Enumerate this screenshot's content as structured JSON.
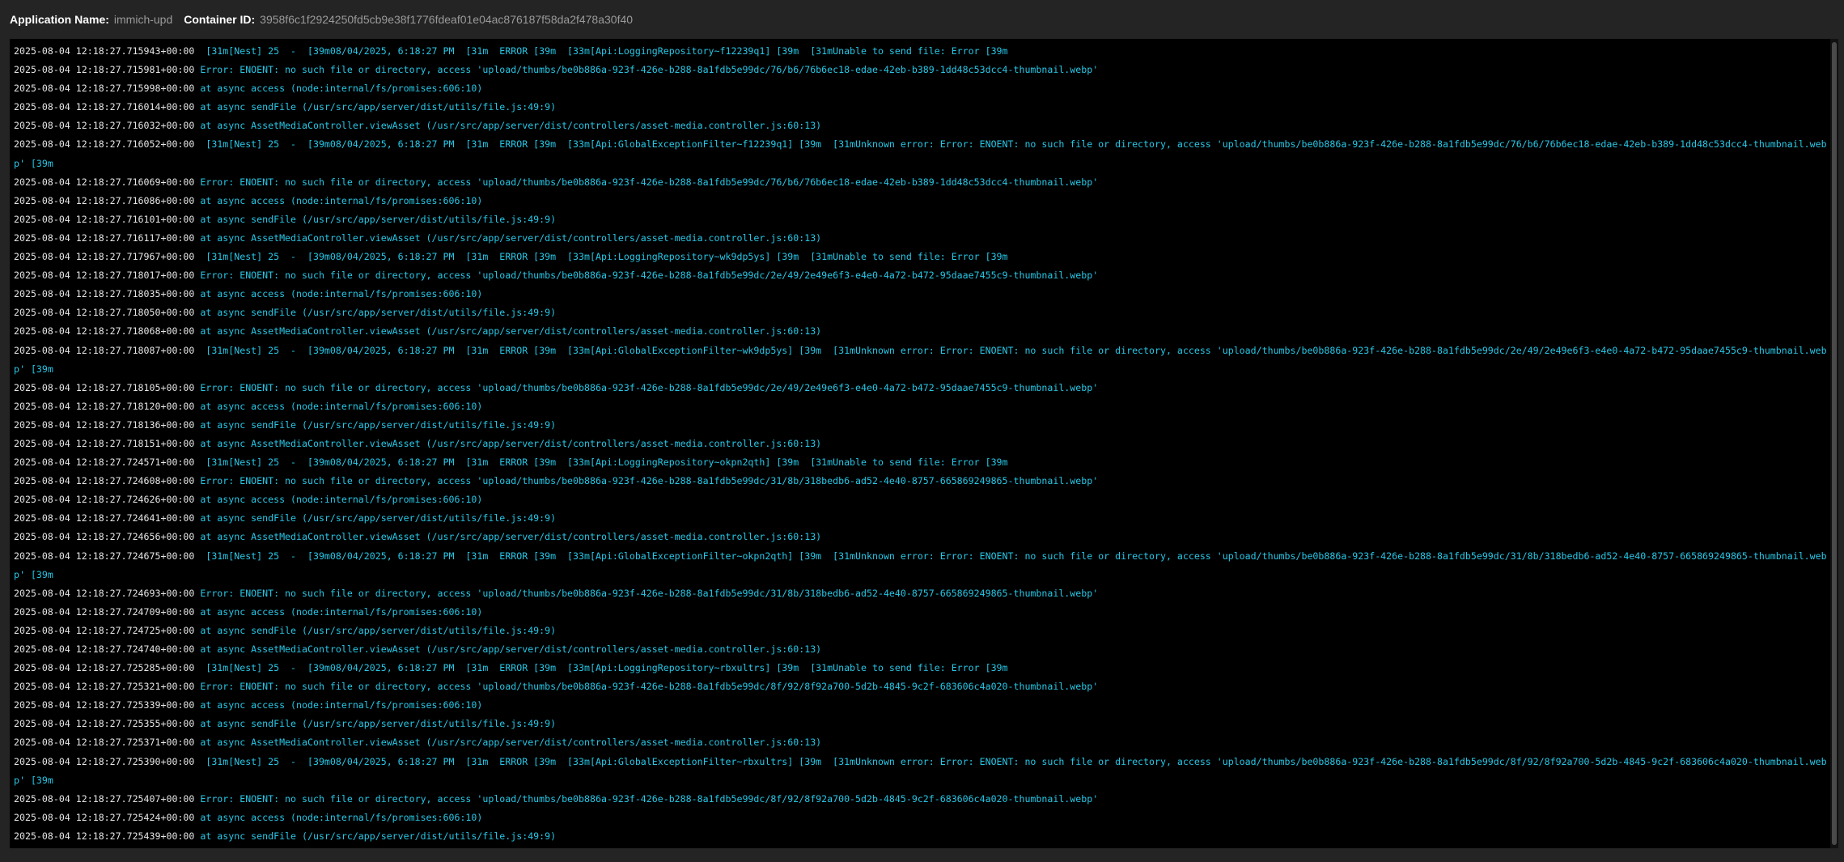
{
  "header": {
    "app_label": "Application Name:",
    "app_value": "immich-upd",
    "container_label": "Container ID:",
    "container_value": "3958f6c1f2924250fd5cb9e38f1776fdeaf01e04ac876187f58da2f478a30f40"
  },
  "colors": {
    "background": "#242424",
    "log_background": "#000000",
    "timestamp": "#e6e6e6",
    "message": "#27c7e6"
  },
  "logs": [
    {
      "ts": "2025-08-04 12:18:27.715943+00:00",
      "msg": " [31m[Nest] 25  -  [39m08/04/2025, 6:18:27 PM  [31m  ERROR [39m  [33m[Api:LoggingRepository~f12239q1] [39m  [31mUnable to send file: Error [39m"
    },
    {
      "ts": "2025-08-04 12:18:27.715981+00:00",
      "msg": "Error: ENOENT: no such file or directory, access 'upload/thumbs/be0b886a-923f-426e-b288-8a1fdb5e99dc/76/b6/76b6ec18-edae-42eb-b389-1dd48c53dcc4-thumbnail.webp'"
    },
    {
      "ts": "2025-08-04 12:18:27.715998+00:00",
      "msg": "at async access (node:internal/fs/promises:606:10)"
    },
    {
      "ts": "2025-08-04 12:18:27.716014+00:00",
      "msg": "at async sendFile (/usr/src/app/server/dist/utils/file.js:49:9)"
    },
    {
      "ts": "2025-08-04 12:18:27.716032+00:00",
      "msg": "at async AssetMediaController.viewAsset (/usr/src/app/server/dist/controllers/asset-media.controller.js:60:13)"
    },
    {
      "ts": "2025-08-04 12:18:27.716052+00:00",
      "msg": " [31m[Nest] 25  -  [39m08/04/2025, 6:18:27 PM  [31m  ERROR [39m  [33m[Api:GlobalExceptionFilter~f12239q1] [39m  [31mUnknown error: Error: ENOENT: no such file or directory, access 'upload/thumbs/be0b886a-923f-426e-b288-8a1fdb5e99dc/76/b6/76b6ec18-edae-42eb-b389-1dd48c53dcc4-thumbnail.webp' [39m"
    },
    {
      "ts": "2025-08-04 12:18:27.716069+00:00",
      "msg": "Error: ENOENT: no such file or directory, access 'upload/thumbs/be0b886a-923f-426e-b288-8a1fdb5e99dc/76/b6/76b6ec18-edae-42eb-b389-1dd48c53dcc4-thumbnail.webp'"
    },
    {
      "ts": "2025-08-04 12:18:27.716086+00:00",
      "msg": "at async access (node:internal/fs/promises:606:10)"
    },
    {
      "ts": "2025-08-04 12:18:27.716101+00:00",
      "msg": "at async sendFile (/usr/src/app/server/dist/utils/file.js:49:9)"
    },
    {
      "ts": "2025-08-04 12:18:27.716117+00:00",
      "msg": "at async AssetMediaController.viewAsset (/usr/src/app/server/dist/controllers/asset-media.controller.js:60:13)"
    },
    {
      "ts": "2025-08-04 12:18:27.717967+00:00",
      "msg": " [31m[Nest] 25  -  [39m08/04/2025, 6:18:27 PM  [31m  ERROR [39m  [33m[Api:LoggingRepository~wk9dp5ys] [39m  [31mUnable to send file: Error [39m"
    },
    {
      "ts": "2025-08-04 12:18:27.718017+00:00",
      "msg": "Error: ENOENT: no such file or directory, access 'upload/thumbs/be0b886a-923f-426e-b288-8a1fdb5e99dc/2e/49/2e49e6f3-e4e0-4a72-b472-95daae7455c9-thumbnail.webp'"
    },
    {
      "ts": "2025-08-04 12:18:27.718035+00:00",
      "msg": "at async access (node:internal/fs/promises:606:10)"
    },
    {
      "ts": "2025-08-04 12:18:27.718050+00:00",
      "msg": "at async sendFile (/usr/src/app/server/dist/utils/file.js:49:9)"
    },
    {
      "ts": "2025-08-04 12:18:27.718068+00:00",
      "msg": "at async AssetMediaController.viewAsset (/usr/src/app/server/dist/controllers/asset-media.controller.js:60:13)"
    },
    {
      "ts": "2025-08-04 12:18:27.718087+00:00",
      "msg": " [31m[Nest] 25  -  [39m08/04/2025, 6:18:27 PM  [31m  ERROR [39m  [33m[Api:GlobalExceptionFilter~wk9dp5ys] [39m  [31mUnknown error: Error: ENOENT: no such file or directory, access 'upload/thumbs/be0b886a-923f-426e-b288-8a1fdb5e99dc/2e/49/2e49e6f3-e4e0-4a72-b472-95daae7455c9-thumbnail.webp' [39m"
    },
    {
      "ts": "2025-08-04 12:18:27.718105+00:00",
      "msg": "Error: ENOENT: no such file or directory, access 'upload/thumbs/be0b886a-923f-426e-b288-8a1fdb5e99dc/2e/49/2e49e6f3-e4e0-4a72-b472-95daae7455c9-thumbnail.webp'"
    },
    {
      "ts": "2025-08-04 12:18:27.718120+00:00",
      "msg": "at async access (node:internal/fs/promises:606:10)"
    },
    {
      "ts": "2025-08-04 12:18:27.718136+00:00",
      "msg": "at async sendFile (/usr/src/app/server/dist/utils/file.js:49:9)"
    },
    {
      "ts": "2025-08-04 12:18:27.718151+00:00",
      "msg": "at async AssetMediaController.viewAsset (/usr/src/app/server/dist/controllers/asset-media.controller.js:60:13)"
    },
    {
      "ts": "2025-08-04 12:18:27.724571+00:00",
      "msg": " [31m[Nest] 25  -  [39m08/04/2025, 6:18:27 PM  [31m  ERROR [39m  [33m[Api:LoggingRepository~okpn2qth] [39m  [31mUnable to send file: Error [39m"
    },
    {
      "ts": "2025-08-04 12:18:27.724608+00:00",
      "msg": "Error: ENOENT: no such file or directory, access 'upload/thumbs/be0b886a-923f-426e-b288-8a1fdb5e99dc/31/8b/318bedb6-ad52-4e40-8757-665869249865-thumbnail.webp'"
    },
    {
      "ts": "2025-08-04 12:18:27.724626+00:00",
      "msg": "at async access (node:internal/fs/promises:606:10)"
    },
    {
      "ts": "2025-08-04 12:18:27.724641+00:00",
      "msg": "at async sendFile (/usr/src/app/server/dist/utils/file.js:49:9)"
    },
    {
      "ts": "2025-08-04 12:18:27.724656+00:00",
      "msg": "at async AssetMediaController.viewAsset (/usr/src/app/server/dist/controllers/asset-media.controller.js:60:13)"
    },
    {
      "ts": "2025-08-04 12:18:27.724675+00:00",
      "msg": " [31m[Nest] 25  -  [39m08/04/2025, 6:18:27 PM  [31m  ERROR [39m  [33m[Api:GlobalExceptionFilter~okpn2qth] [39m  [31mUnknown error: Error: ENOENT: no such file or directory, access 'upload/thumbs/be0b886a-923f-426e-b288-8a1fdb5e99dc/31/8b/318bedb6-ad52-4e40-8757-665869249865-thumbnail.webp' [39m"
    },
    {
      "ts": "2025-08-04 12:18:27.724693+00:00",
      "msg": "Error: ENOENT: no such file or directory, access 'upload/thumbs/be0b886a-923f-426e-b288-8a1fdb5e99dc/31/8b/318bedb6-ad52-4e40-8757-665869249865-thumbnail.webp'"
    },
    {
      "ts": "2025-08-04 12:18:27.724709+00:00",
      "msg": "at async access (node:internal/fs/promises:606:10)"
    },
    {
      "ts": "2025-08-04 12:18:27.724725+00:00",
      "msg": "at async sendFile (/usr/src/app/server/dist/utils/file.js:49:9)"
    },
    {
      "ts": "2025-08-04 12:18:27.724740+00:00",
      "msg": "at async AssetMediaController.viewAsset (/usr/src/app/server/dist/controllers/asset-media.controller.js:60:13)"
    },
    {
      "ts": "2025-08-04 12:18:27.725285+00:00",
      "msg": " [31m[Nest] 25  -  [39m08/04/2025, 6:18:27 PM  [31m  ERROR [39m  [33m[Api:LoggingRepository~rbxultrs] [39m  [31mUnable to send file: Error [39m"
    },
    {
      "ts": "2025-08-04 12:18:27.725321+00:00",
      "msg": "Error: ENOENT: no such file or directory, access 'upload/thumbs/be0b886a-923f-426e-b288-8a1fdb5e99dc/8f/92/8f92a700-5d2b-4845-9c2f-683606c4a020-thumbnail.webp'"
    },
    {
      "ts": "2025-08-04 12:18:27.725339+00:00",
      "msg": "at async access (node:internal/fs/promises:606:10)"
    },
    {
      "ts": "2025-08-04 12:18:27.725355+00:00",
      "msg": "at async sendFile (/usr/src/app/server/dist/utils/file.js:49:9)"
    },
    {
      "ts": "2025-08-04 12:18:27.725371+00:00",
      "msg": "at async AssetMediaController.viewAsset (/usr/src/app/server/dist/controllers/asset-media.controller.js:60:13)"
    },
    {
      "ts": "2025-08-04 12:18:27.725390+00:00",
      "msg": " [31m[Nest] 25  -  [39m08/04/2025, 6:18:27 PM  [31m  ERROR [39m  [33m[Api:GlobalExceptionFilter~rbxultrs] [39m  [31mUnknown error: Error: ENOENT: no such file or directory, access 'upload/thumbs/be0b886a-923f-426e-b288-8a1fdb5e99dc/8f/92/8f92a700-5d2b-4845-9c2f-683606c4a020-thumbnail.webp' [39m"
    },
    {
      "ts": "2025-08-04 12:18:27.725407+00:00",
      "msg": "Error: ENOENT: no such file or directory, access 'upload/thumbs/be0b886a-923f-426e-b288-8a1fdb5e99dc/8f/92/8f92a700-5d2b-4845-9c2f-683606c4a020-thumbnail.webp'"
    },
    {
      "ts": "2025-08-04 12:18:27.725424+00:00",
      "msg": "at async access (node:internal/fs/promises:606:10)"
    },
    {
      "ts": "2025-08-04 12:18:27.725439+00:00",
      "msg": "at async sendFile (/usr/src/app/server/dist/utils/file.js:49:9)"
    }
  ]
}
